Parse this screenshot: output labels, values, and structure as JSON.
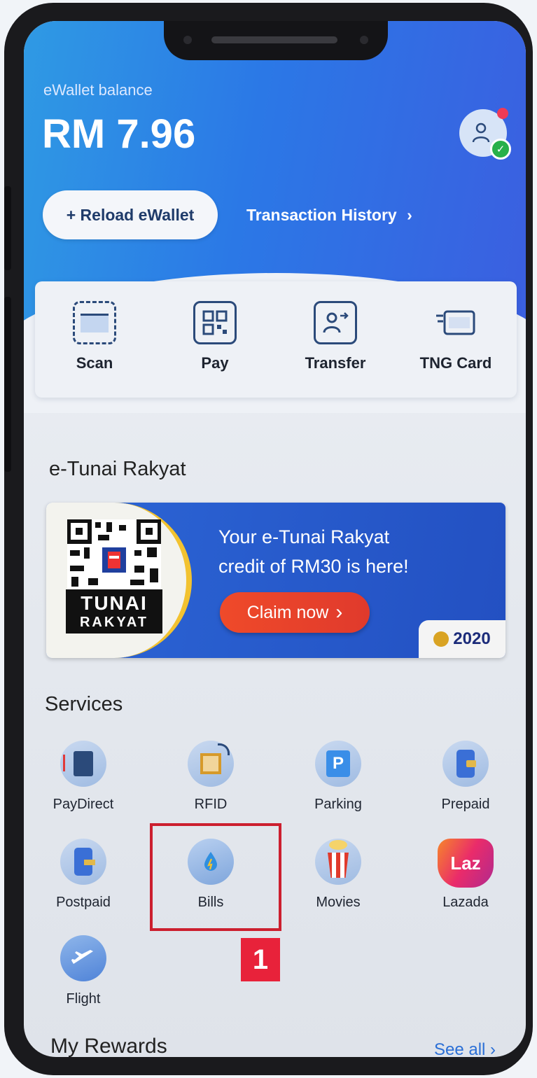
{
  "wallet": {
    "balance_label": "eWallet balance",
    "balance_amount": "RM 7.96",
    "reload_button": "+ Reload eWallet",
    "history_link": "Transaction History",
    "history_chevron": "›"
  },
  "quick_actions": [
    {
      "label": "Scan",
      "icon": "scan-icon"
    },
    {
      "label": "Pay",
      "icon": "qr-pay-icon"
    },
    {
      "label": "Transfer",
      "icon": "transfer-icon"
    },
    {
      "label": "TNG Card",
      "icon": "tng-card-icon"
    }
  ],
  "etunai": {
    "section_title": "e-Tunai Rakyat",
    "banner_line1": "Your e-Tunai Rakyat",
    "banner_line2": "credit of RM30 is here!",
    "claim_button": "Claim now",
    "claim_chevron": "›",
    "logo_line1": "TUNAI",
    "logo_line2": "RAKYAT",
    "badge_year": "2020"
  },
  "services": {
    "section_title": "Services",
    "items": [
      {
        "label": "PayDirect",
        "icon": "paydirect-icon"
      },
      {
        "label": "RFID",
        "icon": "rfid-icon"
      },
      {
        "label": "Parking",
        "icon": "parking-icon"
      },
      {
        "label": "Prepaid",
        "icon": "prepaid-icon"
      },
      {
        "label": "Postpaid",
        "icon": "postpaid-icon"
      },
      {
        "label": "Bills",
        "icon": "bills-icon"
      },
      {
        "label": "Movies",
        "icon": "movies-icon"
      },
      {
        "label": "Lazada",
        "icon": "lazada-icon"
      },
      {
        "label": "Flight",
        "icon": "flight-icon"
      }
    ],
    "parking_glyph": "P",
    "lazada_glyph": "Laz"
  },
  "annotation": {
    "step_number": "1"
  },
  "rewards": {
    "section_title": "My Rewards",
    "see_all": "See all ›"
  },
  "colors": {
    "brand_blue": "#2b78e6",
    "highlight_red": "#cc1f2f",
    "claim_orange": "#ef4a2a"
  }
}
